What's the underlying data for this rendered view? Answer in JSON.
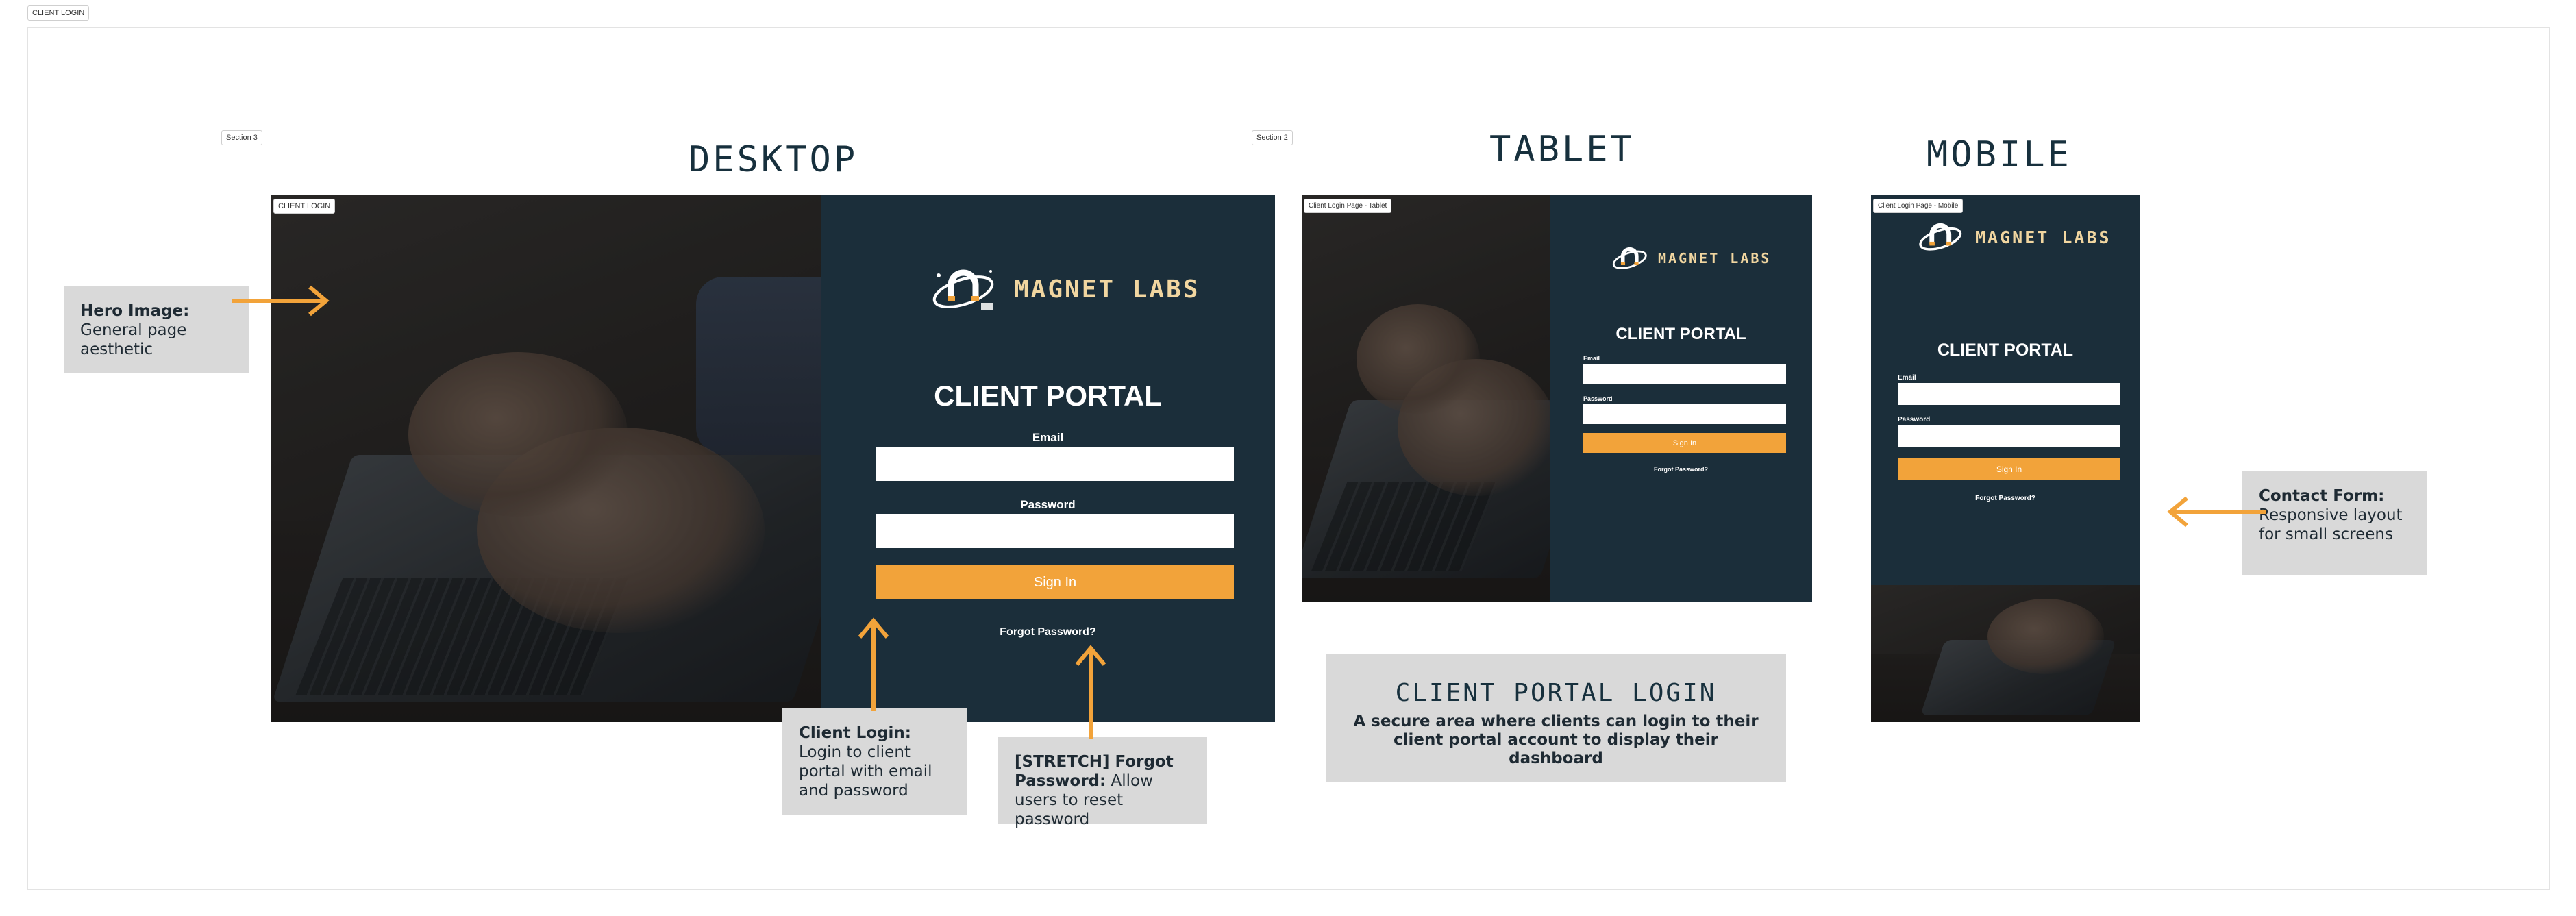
{
  "page": {
    "frame_label": "CLIENT LOGIN"
  },
  "section_tags": {
    "section3": "Section 3",
    "section2": "Section 2"
  },
  "headings": {
    "desktop": "DESKTOP",
    "tablet": "TABLET",
    "mobile": "MOBILE"
  },
  "desktop": {
    "tag": "CLIENT LOGIN",
    "logo_text": "MAGNET LABS",
    "title": "CLIENT PORTAL",
    "email_label": "Email",
    "password_label": "Password",
    "sign_in": "Sign In",
    "forgot": "Forgot Password?"
  },
  "tablet": {
    "tag": "Client Login Page - Tablet",
    "logo_text": "MAGNET LABS",
    "title": "CLIENT PORTAL",
    "email_label": "Email",
    "password_label": "Password",
    "sign_in": "Sign In",
    "forgot": "Forgot Password?"
  },
  "mobile": {
    "tag": "Client Login Page - Mobile",
    "logo_text": "MAGNET LABS",
    "title": "CLIENT PORTAL",
    "email_label": "Email",
    "password_label": "Password",
    "sign_in": "Sign In",
    "forgot": "Forgot Password?"
  },
  "notes": {
    "hero": {
      "title": "Hero Image:",
      "body": "General page aesthetic"
    },
    "client_login": {
      "title": "Client Login:",
      "body": "Login to client portal with email and password"
    },
    "forgot": {
      "title": "[STRETCH] Forgot Password:",
      "body": "Allow users to reset password"
    },
    "contact": {
      "title": "Contact Form:",
      "body": "Responsive layout for small screens"
    },
    "summary": {
      "title": "CLIENT PORTAL LOGIN",
      "body": "A secure area where clients can login to their client portal account to display their dashboard"
    }
  },
  "colors": {
    "panel": "#1b2e3a",
    "accent": "#f2a33a",
    "logo": "#f1d6a0",
    "note_bg": "#d9d9d9"
  }
}
